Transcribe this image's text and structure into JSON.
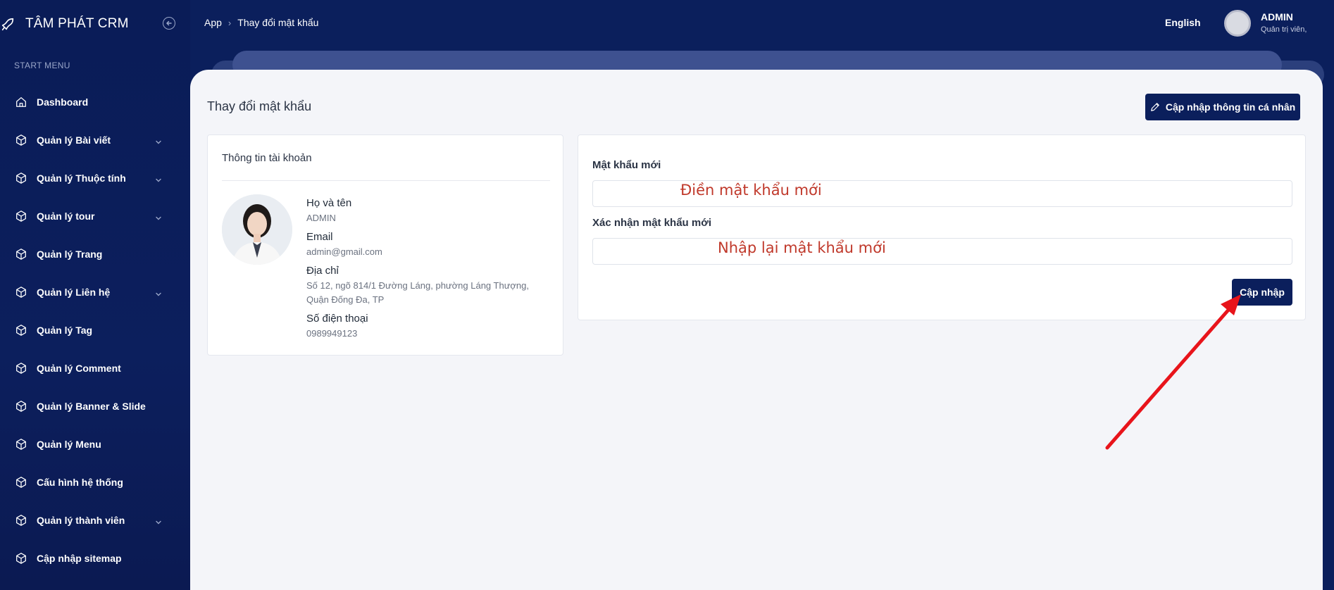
{
  "brand": {
    "name": "TÂM PHÁT CRM"
  },
  "sidebar": {
    "section_label": "START MENU",
    "items": [
      {
        "label": "Dashboard",
        "icon": "home-icon",
        "has_submenu": false
      },
      {
        "label": "Quản lý Bài viết",
        "icon": "cube-icon",
        "has_submenu": true
      },
      {
        "label": "Quản lý Thuộc tính",
        "icon": "cube-icon",
        "has_submenu": true
      },
      {
        "label": "Quản lý tour",
        "icon": "cube-icon",
        "has_submenu": true
      },
      {
        "label": "Quản lý Trang",
        "icon": "cube-icon",
        "has_submenu": false
      },
      {
        "label": "Quản lý Liên hệ",
        "icon": "cube-icon",
        "has_submenu": true
      },
      {
        "label": "Quản lý Tag",
        "icon": "cube-icon",
        "has_submenu": false
      },
      {
        "label": "Quản lý Comment",
        "icon": "cube-icon",
        "has_submenu": false
      },
      {
        "label": "Quản lý Banner & Slide",
        "icon": "cube-icon",
        "has_submenu": false
      },
      {
        "label": "Quản lý Menu",
        "icon": "cube-icon",
        "has_submenu": false
      },
      {
        "label": "Cấu hình hệ thống",
        "icon": "cube-icon",
        "has_submenu": false
      },
      {
        "label": "Quản lý thành viên",
        "icon": "cube-icon",
        "has_submenu": true
      },
      {
        "label": "Cập nhập sitemap",
        "icon": "cube-icon",
        "has_submenu": false
      }
    ]
  },
  "topbar": {
    "breadcrumb": [
      "App",
      "Thay đổi mật khẩu"
    ],
    "language": "English",
    "user": {
      "name": "ADMIN",
      "role": "Quản trị viên,"
    }
  },
  "page": {
    "title": "Thay đổi mật khẩu",
    "update_profile_label": "Cập nhập thông tin cá nhân"
  },
  "account_card": {
    "title": "Thông tin tài khoản",
    "fields": [
      {
        "label": "Họ và tên",
        "value": "ADMIN"
      },
      {
        "label": "Email",
        "value": "admin@gmail.com"
      },
      {
        "label": "Địa chỉ",
        "value": "Số 12, ngõ 814/1 Đường Láng, phường Láng Thượng, Quận Đống Đa, TP"
      },
      {
        "label": "Số điện thoại",
        "value": "0989949123"
      }
    ]
  },
  "password_card": {
    "new_password_label": "Mật khẩu mới",
    "new_password_value": "",
    "confirm_password_label": "Xác nhận mật khẩu mới",
    "confirm_password_value": "",
    "submit_label": "Cập nhập"
  },
  "annotations": {
    "new_password_hint": "Điền mật khẩu mới",
    "confirm_password_hint": "Nhập lại mật khẩu mới",
    "arrow_color": "#e8141b"
  },
  "colors": {
    "primary": "#0b1f5c",
    "annotation_text": "#c0392b"
  }
}
